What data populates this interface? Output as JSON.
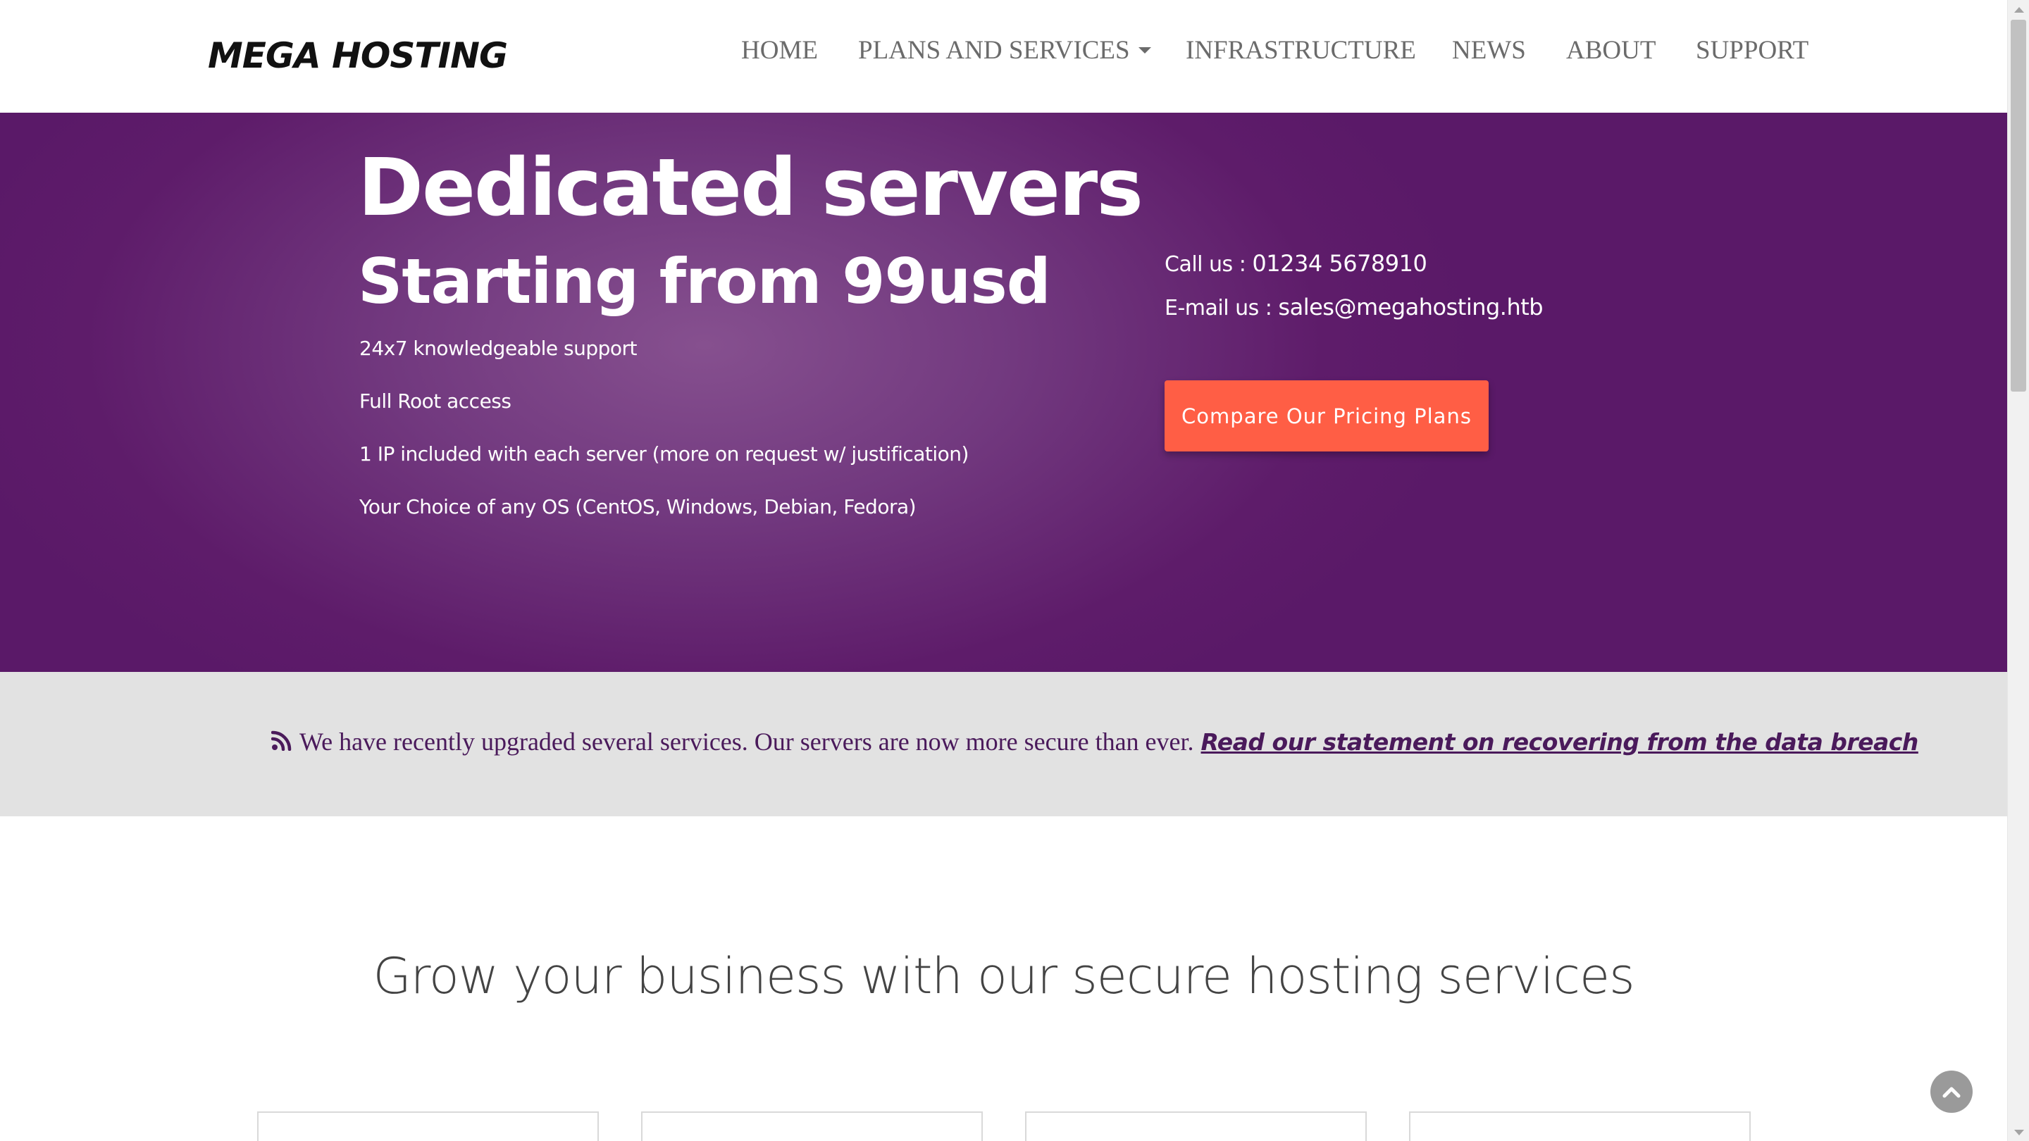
{
  "brand": {
    "logo_text": "MEGA HOSTING"
  },
  "nav": {
    "items": [
      {
        "label": "HOME"
      },
      {
        "label": "PLANS AND SERVICES",
        "has_dropdown": true
      },
      {
        "label": "INFRASTRUCTURE"
      },
      {
        "label": "NEWS"
      },
      {
        "label": "ABOUT"
      },
      {
        "label": "SUPPORT"
      }
    ]
  },
  "hero": {
    "title": "Dedicated servers",
    "subtitle": "Starting from 99usd",
    "features": [
      "24x7 knowledgeable support",
      "Full Root access",
      "1 IP included with each server (more on request w/ justification)",
      "Your Choice of any OS (CentOS, Windows, Debian, Fedora)"
    ],
    "contact": {
      "phone_label": "Call us : ",
      "phone": "01234 5678910",
      "email_label": "E-mail us : ",
      "email": "sales@megahosting.htb"
    },
    "cta_label": "Compare Our Pricing Plans"
  },
  "announcement": {
    "icon": "rss-icon",
    "text": "We have recently upgraded several services. Our servers are now more secure than ever.",
    "link_text": "Read our statement on recovering from the data breach"
  },
  "section": {
    "heading": "Grow your business with our secure hosting services"
  },
  "colors": {
    "hero_bg": "#5e1c6a",
    "cta": "#ff5e45",
    "announce_bg": "#e2e2e2",
    "announce_text": "#4a1a5b"
  },
  "icons": {
    "back_to_top": "chevron-up-icon",
    "dropdown": "caret-down-icon"
  }
}
